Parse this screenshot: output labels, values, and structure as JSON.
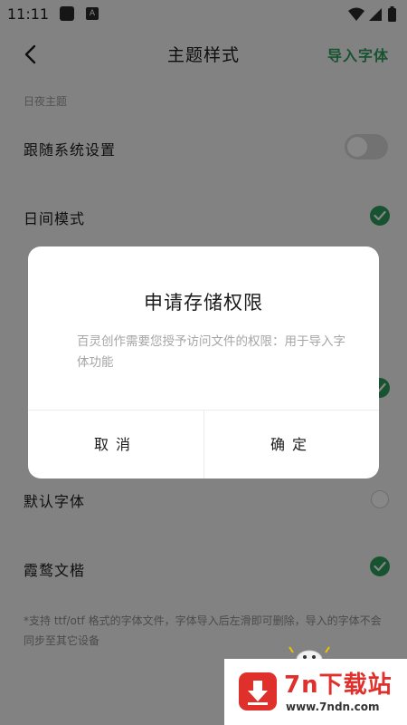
{
  "status_bar": {
    "time": "11:11",
    "notification_icons": [
      "square-icon",
      "a-icon"
    ],
    "right_icons": [
      "wifi-icon",
      "signal-icon",
      "battery-icon"
    ]
  },
  "header": {
    "title": "主题样式",
    "action": "导入字体"
  },
  "day_night": {
    "section_label": "日夜主题",
    "follow_system": {
      "label": "跟随系统设置",
      "enabled": false
    },
    "day_mode": {
      "label": "日间模式",
      "selected": true
    }
  },
  "font": {
    "default_font": {
      "label": "默认字体",
      "selected": false
    },
    "xiawu_kai": {
      "label": "霞鹜文楷",
      "selected": true
    },
    "footnote": "*支持 ttf/otf 格式的字体文件，字体导入后左滑即可删除，导入的字体不会同步至其它设备"
  },
  "dialog": {
    "title": "申请存储权限",
    "message": "百灵创作需要您授予访问文件的权限：用于导入字体功能",
    "cancel": "取消",
    "confirm": "确定"
  },
  "watermark": {
    "brand": "7n下载站",
    "url": "www.7ndn.com"
  },
  "colors": {
    "accent": "#2f9d5e",
    "watermark": "#e0302c",
    "overlay": "rgba(0,0,0,0.47)"
  }
}
